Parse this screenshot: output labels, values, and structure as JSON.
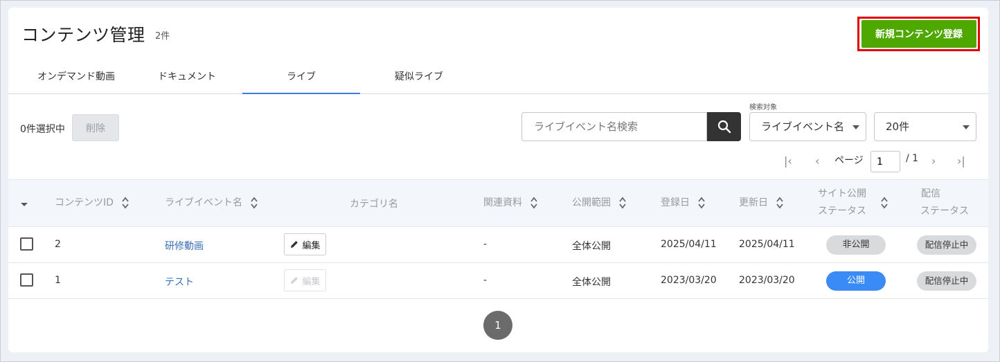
{
  "header": {
    "title": "コンテンツ管理",
    "count": "2件",
    "new_button": "新規コンテンツ登録"
  },
  "tabs": [
    {
      "label": "オンデマンド動画",
      "active": false
    },
    {
      "label": "ドキュメント",
      "active": false
    },
    {
      "label": "ライブ",
      "active": true
    },
    {
      "label": "疑似ライブ",
      "active": false
    }
  ],
  "toolbar": {
    "selected_text": "0件選択中",
    "delete_label": "削除",
    "search_placeholder": "ライブイベント名検索",
    "search_target_label": "検索対象",
    "search_target_value": "ライブイベント名",
    "page_size_value": "20件"
  },
  "pagination": {
    "page_label": "ページ",
    "current_page": "1",
    "total_pages": "/ 1",
    "bottom_page": "1"
  },
  "table": {
    "headers": {
      "content_id": "コンテンツID",
      "event_name": "ライブイベント名",
      "category": "カテゴリ名",
      "materials": "関連資料",
      "scope": "公開範囲",
      "registered": "登録日",
      "updated": "更新日",
      "site_status_1": "サイト公開",
      "site_status_2": "ステータス",
      "delivery_status_1": "配信",
      "delivery_status_2": "ステータス"
    },
    "rows": [
      {
        "id": "2",
        "name": "研修動画",
        "edit_label": "編集",
        "edit_enabled": true,
        "materials": "-",
        "scope": "全体公開",
        "registered": "2025/04/11",
        "updated": "2025/04/11",
        "site_status": "非公開",
        "delivery_status": "配信停止中"
      },
      {
        "id": "1",
        "name": "テスト",
        "edit_label": "編集",
        "edit_enabled": false,
        "materials": "-",
        "scope": "全体公開",
        "registered": "2023/03/20",
        "updated": "2023/03/20",
        "site_status": "公開",
        "delivery_status": "配信停止中"
      }
    ]
  },
  "colors": {
    "accent_green": "#4fa800",
    "highlight_red": "#e00000",
    "public_blue": "#3a8bf5",
    "link_blue": "#3a6fb5"
  }
}
